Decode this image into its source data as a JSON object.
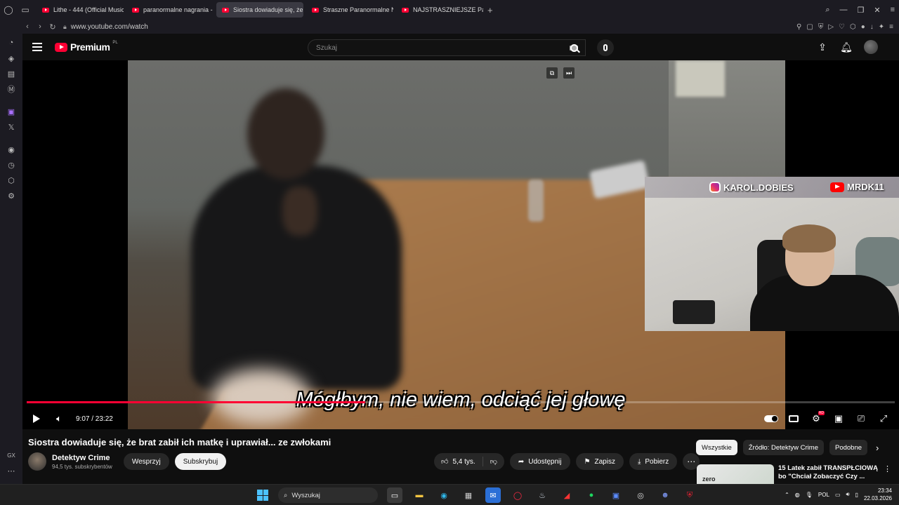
{
  "browser": {
    "tabs": [
      {
        "title": "Lithe - 444 (Official Music",
        "active": false
      },
      {
        "title": "paranormalne nagrania -",
        "active": false
      },
      {
        "title": "Siostra dowiaduje się, że",
        "active": true
      },
      {
        "title": "Straszne Paranormalne N",
        "active": false
      },
      {
        "title": "NAJSTRASZNIEJSZE Para",
        "active": false
      }
    ],
    "url": "www.youtube.com/watch"
  },
  "yt_header": {
    "brand": "Premium",
    "region": "PL",
    "search_placeholder": "Szukaj"
  },
  "player": {
    "subtitle": "Mógłbym, nie wiem, odciąć jej głowę",
    "time": "9:07 / 23:22",
    "progress": 0.39
  },
  "webcam": {
    "instagram": "KAROL.DOBIES",
    "youtube": "MRDK11"
  },
  "video": {
    "title": "Siostra dowiaduje się, że brat zabił ich matkę i uprawiał... ze zwłokami",
    "channel": "Detektyw Crime",
    "subscribers": "94,5 tys. subskrybentów",
    "support_label": "Wesprzyj",
    "subscribe_label": "Subskrybuj",
    "likes": "5,4 tys.",
    "share_label": "Udostępnij",
    "save_label": "Zapisz",
    "download_label": "Pobierz"
  },
  "sidebar_chips": [
    "Wszystkie",
    "Źródło: Detektyw Crime",
    "Podobne"
  ],
  "recommendation": {
    "title": "15 Latek zabił TRANSPŁCIOWĄ bo \"Chciał Zobaczyć Czy ...",
    "thumb_text": "zero"
  },
  "taskbar": {
    "search_placeholder": "Wyszukaj",
    "lang": "POL",
    "time": "23:34",
    "date": "22.03.2026"
  },
  "colors": {
    "accent": "#ff0033",
    "background": "#0f0f0f"
  }
}
